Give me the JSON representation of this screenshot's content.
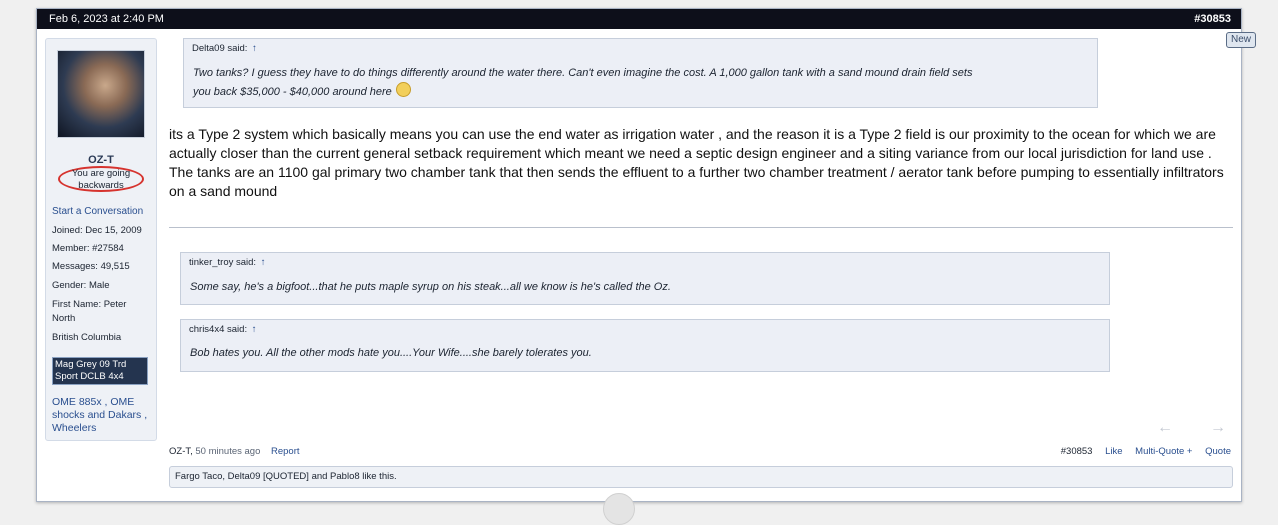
{
  "header": {
    "date": "Feb 6, 2023 at 2:40 PM",
    "post_number": "#30853"
  },
  "new_badge": "New",
  "user": {
    "name": "OZ-T",
    "title_line1": "You are going",
    "title_line2": "backwards",
    "start_conversation": "Start a Conversation",
    "joined": "Joined:  Dec 15, 2009",
    "member": "Member:  #27584",
    "messages": "Messages:  49,515",
    "gender": "Gender:  Male",
    "first_name_line1": "First Name: Peter",
    "first_name_line2": "North",
    "location": "British Columbia",
    "vehicle": "Mag Grey 09 Trd Sport DCLB 4x4",
    "mods": "OME 885x , OME shocks and Dakars , Wheelers"
  },
  "quotes": [
    {
      "author": "Delta09 said:",
      "arrow": "↑",
      "line1": "Two tanks? I guess they have to do things differently around the water there. Can't even imagine the cost. A 1,000 gallon tank with a sand mound drain field sets",
      "line2": "you back $35,000 - $40,000 around here"
    },
    {
      "author": "tinker_troy said:",
      "arrow": "↑",
      "text": "Some say, he's a bigfoot...that he puts maple syrup on his steak...all we know is he's called the Oz."
    },
    {
      "author": "chris4x4 said:",
      "arrow": "↑",
      "text": "Bob hates you. All the other mods hate you....Your Wife....she barely tolerates you."
    }
  ],
  "post_text": "its a Type 2 system which basically means you can use the end water as irrigation water , and the reason it is a Type 2 field is our proximity to the ocean for which we are actually closer than the current general setback requirement which meant we need a septic design engineer and a siting variance from our local jurisdiction for land use . The tanks are an 1100 gal primary two chamber tank that then sends the effluent to a further two chamber treatment / aerator tank before pumping to essentially infiltrators on a sand mound",
  "nav": {
    "prev": "←",
    "next": "→"
  },
  "footer": {
    "author": "OZ-T,",
    "time": "50 minutes ago",
    "report": "Report",
    "post_number": "#30853",
    "like": "Like",
    "multi_quote": "Multi-Quote +",
    "quote": "Quote"
  },
  "likes": "Fargo Taco, Delta09 [QUOTED] and Pablo8 like this."
}
